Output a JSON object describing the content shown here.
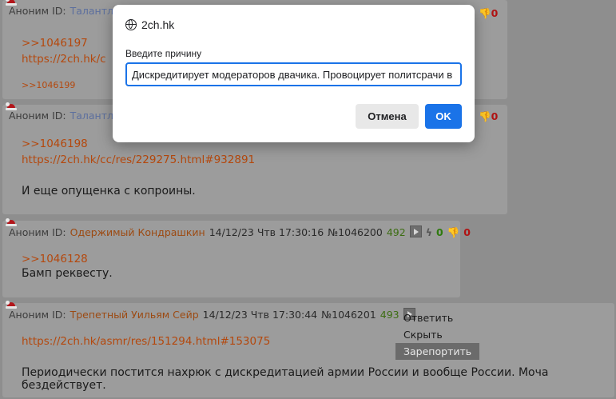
{
  "dialog": {
    "site": "2ch.hk",
    "label": "Введите причину",
    "input_value": "Дискредитирует модераторов двачика. Провоцирует политсрачи в А",
    "cancel": "Отмена",
    "ok": "OK"
  },
  "posts": [
    {
      "anon": "Аноним ID:",
      "nick": "Талантли",
      "link1": ">>1046197",
      "link2": "https://2ch.hk/c",
      "reply": ">>1046199",
      "votes": {
        "down": "0"
      }
    },
    {
      "anon": "Аноним ID:",
      "nick": "Талантли",
      "link1": ">>1046198",
      "link2": "https://2ch.hk/cc/res/229275.html#932891",
      "text": "И еще опущенка с копроины.",
      "votes": {
        "down": "0"
      }
    },
    {
      "anon": "Аноним ID:",
      "nick": "Одержимый Кондрашкин",
      "date": "14/12/23 Чтв 17:30:16",
      "num": "№1046200",
      "count": "492",
      "link1": ">>1046128",
      "text": "Бамп реквесту.",
      "votes": {
        "up": "0",
        "down": "0"
      }
    },
    {
      "anon": "Аноним ID:",
      "nick": "Трепетный Уильям Сейр",
      "date": "14/12/23 Чтв 17:30:44",
      "num": "№1046201",
      "count": "493",
      "link1": "https://2ch.hk/asmr/res/151294.html#153075",
      "text": "Периодически постится нахрюк с дискредитацией армии России и вообще России. Моча бездействует."
    }
  ],
  "context_menu": {
    "items": [
      "Ответить",
      "Скрыть",
      "Зарепортить"
    ]
  },
  "colors": {
    "link": "#b4480d",
    "nick_orange": "#9c4a12",
    "ok_button": "#1a73e8",
    "vote_up": "#2e7a0e",
    "vote_down": "#b01212"
  }
}
